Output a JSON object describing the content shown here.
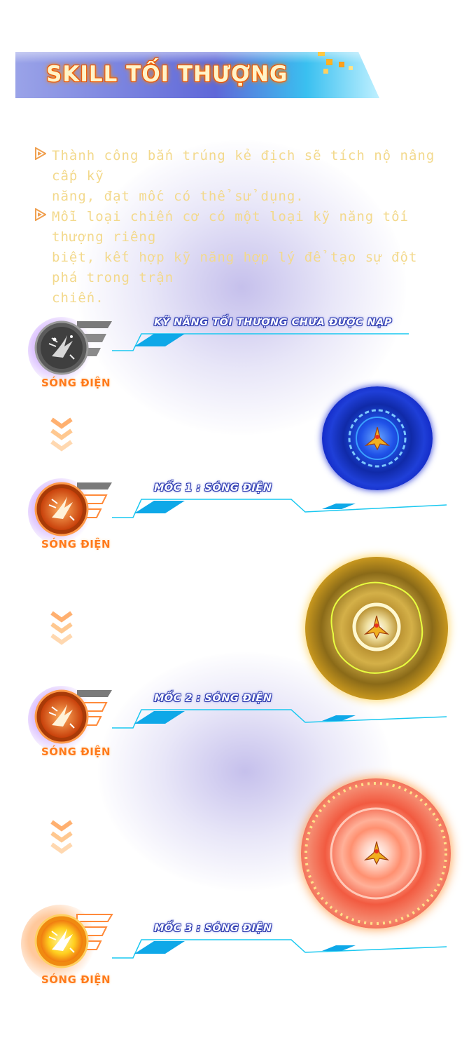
{
  "title": "SKILL TỐI THƯỢNG",
  "descriptions": [
    {
      "line1": "Thành công bắn trúng kẻ địch sẽ tích nộ nâng cấp kỹ",
      "line2": "năng, đạt mốc có thể sử dụng."
    },
    {
      "line1": "Mỗi loại chiến cơ có một loại kỹ năng tối thượng riêng",
      "line2": "biệt, kết hợp kỹ năng hợp lý để tạo sự đột phá trong trận",
      "line3": "chiến."
    }
  ],
  "stages": [
    {
      "label": "KỸ NĂNG TỐI THƯỢNG CHƯA ĐƯỢC NẠP",
      "skill_name": "SÓNG ĐIỆN",
      "state": "inactive"
    },
    {
      "label": "MỐC 1 : SÓNG ĐIỆN",
      "skill_name": "SÓNG ĐIỆN",
      "state": "level1"
    },
    {
      "label": "MỐC 2 : SÓNG ĐIỆN",
      "skill_name": "SÓNG ĐIỆN",
      "state": "level2"
    },
    {
      "label": "MỐC 3 : SÓNG ĐIỆN",
      "skill_name": "SÓNG ĐIỆN",
      "state": "level3"
    }
  ],
  "icons": {
    "bullet": "triangle-bullet-icon",
    "skill": "electric-wave-skill-icon",
    "arrow": "chevron-down-icon",
    "ship": "fighter-ship-icon"
  },
  "colors": {
    "title_text": "#fff4c8",
    "title_outline": "#d9480f",
    "desc_text": "#f3d98c",
    "skill_name": "#ff7a1a",
    "line_cyan": "#19c8f0",
    "orb1": "#1f3fd8",
    "orb2": "#d9a420",
    "orb3": "#f0543c"
  }
}
